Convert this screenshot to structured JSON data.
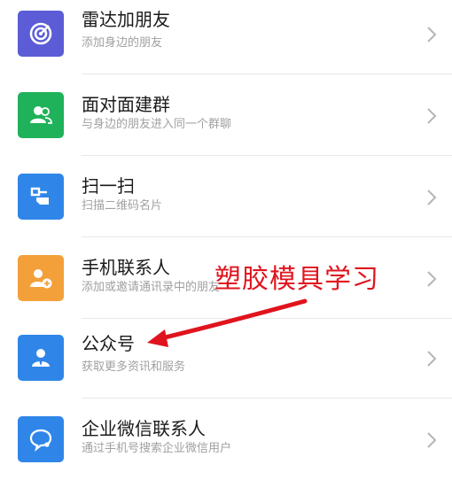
{
  "items": [
    {
      "title": "雷达加朋友",
      "subtitle": "添加身边的朋友",
      "icon": "radar-icon",
      "color": "#5b5cd6"
    },
    {
      "title": "面对面建群",
      "subtitle": "与身边的朋友进入同一个群聊",
      "icon": "group-icon",
      "color": "#20b25a"
    },
    {
      "title": "扫一扫",
      "subtitle": "扫描二维码名片",
      "icon": "scan-icon",
      "color": "#2f86e8"
    },
    {
      "title": "手机联系人",
      "subtitle": "添加或邀请通讯录中的朋友",
      "icon": "add-contact-icon",
      "color": "#f4a03a"
    },
    {
      "title": "公众号",
      "subtitle": "获取更多资讯和服务",
      "icon": "official-account-icon",
      "color": "#2f86e8"
    },
    {
      "title": "企业微信联系人",
      "subtitle": "通过手机号搜索企业微信用户",
      "icon": "work-chat-icon",
      "color": "#2f86e8"
    }
  ],
  "annotation": {
    "text": "塑胶模具学习",
    "color": "#e0141e"
  }
}
